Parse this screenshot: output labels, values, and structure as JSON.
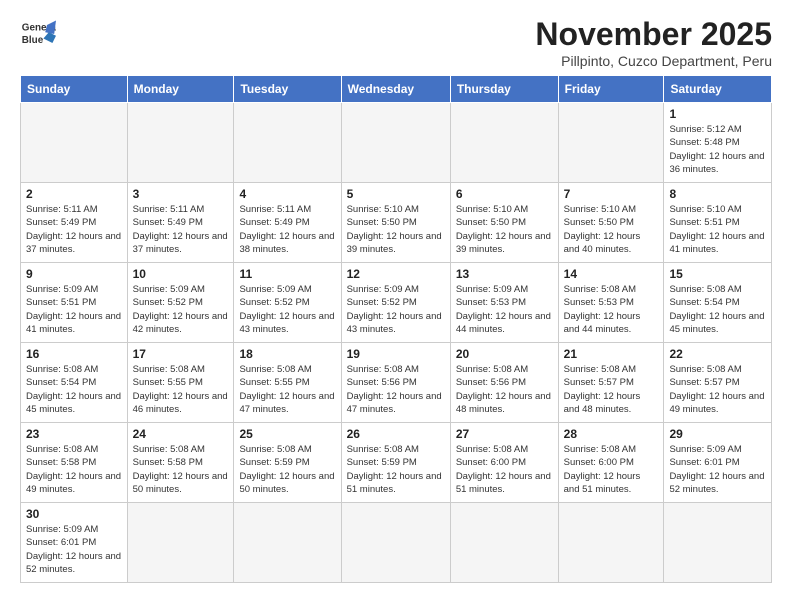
{
  "header": {
    "logo_line1": "General",
    "logo_line2": "Blue",
    "month_title": "November 2025",
    "location": "Pillpinto, Cuzco Department, Peru"
  },
  "weekdays": [
    "Sunday",
    "Monday",
    "Tuesday",
    "Wednesday",
    "Thursday",
    "Friday",
    "Saturday"
  ],
  "weeks": [
    [
      {
        "day": "",
        "info": ""
      },
      {
        "day": "",
        "info": ""
      },
      {
        "day": "",
        "info": ""
      },
      {
        "day": "",
        "info": ""
      },
      {
        "day": "",
        "info": ""
      },
      {
        "day": "",
        "info": ""
      },
      {
        "day": "1",
        "info": "Sunrise: 5:12 AM\nSunset: 5:48 PM\nDaylight: 12 hours and 36 minutes."
      }
    ],
    [
      {
        "day": "2",
        "info": "Sunrise: 5:11 AM\nSunset: 5:49 PM\nDaylight: 12 hours and 37 minutes."
      },
      {
        "day": "3",
        "info": "Sunrise: 5:11 AM\nSunset: 5:49 PM\nDaylight: 12 hours and 37 minutes."
      },
      {
        "day": "4",
        "info": "Sunrise: 5:11 AM\nSunset: 5:49 PM\nDaylight: 12 hours and 38 minutes."
      },
      {
        "day": "5",
        "info": "Sunrise: 5:10 AM\nSunset: 5:50 PM\nDaylight: 12 hours and 39 minutes."
      },
      {
        "day": "6",
        "info": "Sunrise: 5:10 AM\nSunset: 5:50 PM\nDaylight: 12 hours and 39 minutes."
      },
      {
        "day": "7",
        "info": "Sunrise: 5:10 AM\nSunset: 5:50 PM\nDaylight: 12 hours and 40 minutes."
      },
      {
        "day": "8",
        "info": "Sunrise: 5:10 AM\nSunset: 5:51 PM\nDaylight: 12 hours and 41 minutes."
      }
    ],
    [
      {
        "day": "9",
        "info": "Sunrise: 5:09 AM\nSunset: 5:51 PM\nDaylight: 12 hours and 41 minutes."
      },
      {
        "day": "10",
        "info": "Sunrise: 5:09 AM\nSunset: 5:52 PM\nDaylight: 12 hours and 42 minutes."
      },
      {
        "day": "11",
        "info": "Sunrise: 5:09 AM\nSunset: 5:52 PM\nDaylight: 12 hours and 43 minutes."
      },
      {
        "day": "12",
        "info": "Sunrise: 5:09 AM\nSunset: 5:52 PM\nDaylight: 12 hours and 43 minutes."
      },
      {
        "day": "13",
        "info": "Sunrise: 5:09 AM\nSunset: 5:53 PM\nDaylight: 12 hours and 44 minutes."
      },
      {
        "day": "14",
        "info": "Sunrise: 5:08 AM\nSunset: 5:53 PM\nDaylight: 12 hours and 44 minutes."
      },
      {
        "day": "15",
        "info": "Sunrise: 5:08 AM\nSunset: 5:54 PM\nDaylight: 12 hours and 45 minutes."
      }
    ],
    [
      {
        "day": "16",
        "info": "Sunrise: 5:08 AM\nSunset: 5:54 PM\nDaylight: 12 hours and 45 minutes."
      },
      {
        "day": "17",
        "info": "Sunrise: 5:08 AM\nSunset: 5:55 PM\nDaylight: 12 hours and 46 minutes."
      },
      {
        "day": "18",
        "info": "Sunrise: 5:08 AM\nSunset: 5:55 PM\nDaylight: 12 hours and 47 minutes."
      },
      {
        "day": "19",
        "info": "Sunrise: 5:08 AM\nSunset: 5:56 PM\nDaylight: 12 hours and 47 minutes."
      },
      {
        "day": "20",
        "info": "Sunrise: 5:08 AM\nSunset: 5:56 PM\nDaylight: 12 hours and 48 minutes."
      },
      {
        "day": "21",
        "info": "Sunrise: 5:08 AM\nSunset: 5:57 PM\nDaylight: 12 hours and 48 minutes."
      },
      {
        "day": "22",
        "info": "Sunrise: 5:08 AM\nSunset: 5:57 PM\nDaylight: 12 hours and 49 minutes."
      }
    ],
    [
      {
        "day": "23",
        "info": "Sunrise: 5:08 AM\nSunset: 5:58 PM\nDaylight: 12 hours and 49 minutes."
      },
      {
        "day": "24",
        "info": "Sunrise: 5:08 AM\nSunset: 5:58 PM\nDaylight: 12 hours and 50 minutes."
      },
      {
        "day": "25",
        "info": "Sunrise: 5:08 AM\nSunset: 5:59 PM\nDaylight: 12 hours and 50 minutes."
      },
      {
        "day": "26",
        "info": "Sunrise: 5:08 AM\nSunset: 5:59 PM\nDaylight: 12 hours and 51 minutes."
      },
      {
        "day": "27",
        "info": "Sunrise: 5:08 AM\nSunset: 6:00 PM\nDaylight: 12 hours and 51 minutes."
      },
      {
        "day": "28",
        "info": "Sunrise: 5:08 AM\nSunset: 6:00 PM\nDaylight: 12 hours and 51 minutes."
      },
      {
        "day": "29",
        "info": "Sunrise: 5:09 AM\nSunset: 6:01 PM\nDaylight: 12 hours and 52 minutes."
      }
    ],
    [
      {
        "day": "30",
        "info": "Sunrise: 5:09 AM\nSunset: 6:01 PM\nDaylight: 12 hours and 52 minutes."
      },
      {
        "day": "",
        "info": ""
      },
      {
        "day": "",
        "info": ""
      },
      {
        "day": "",
        "info": ""
      },
      {
        "day": "",
        "info": ""
      },
      {
        "day": "",
        "info": ""
      },
      {
        "day": "",
        "info": ""
      }
    ]
  ]
}
